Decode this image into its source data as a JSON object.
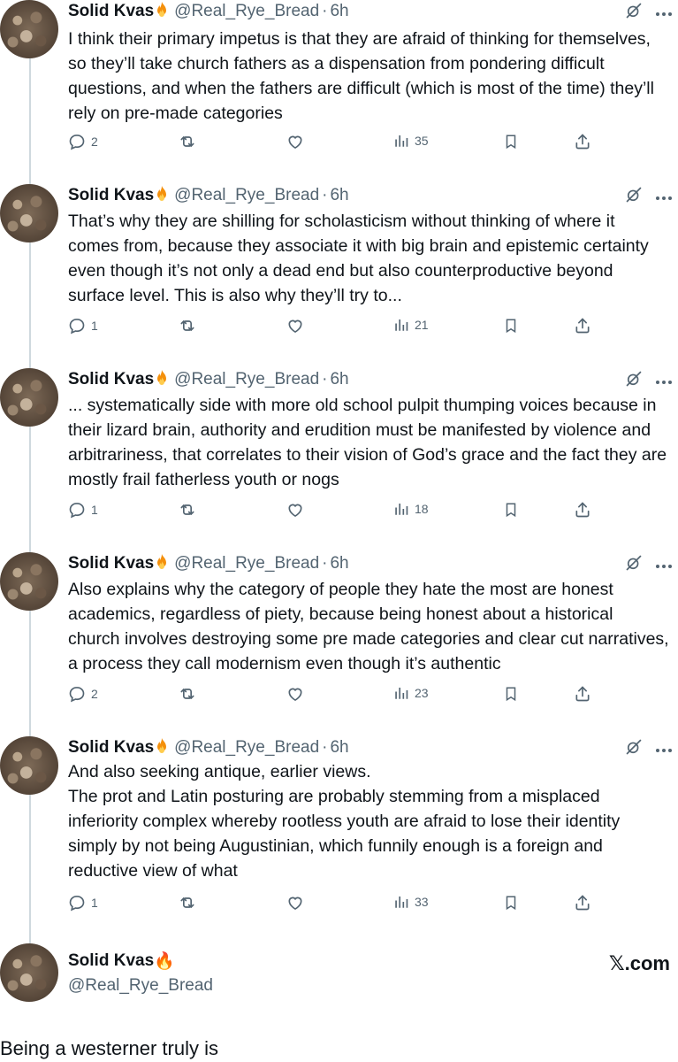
{
  "author": {
    "name": "Solid Kvas",
    "emoji": "🔥",
    "handle": "@Real_Rye_Bread",
    "separator": "·"
  },
  "tweets": [
    {
      "time": "6h",
      "text": "I think their primary impetus is that they are afraid of thinking for themselves, so they’ll take church fathers as a dispensation from pondering difficult questions, and when the fathers are difficult (which is most of the time) they’ll rely on pre-made categories",
      "replies": "2",
      "views": "35"
    },
    {
      "time": "6h",
      "text": "That’s why they are shilling for scholasticism without thinking of where it comes from, because they associate it with big brain and epistemic certainty even though it’s not only a dead end but also counterproductive beyond surface level. This is also why they’ll try to...",
      "replies": "1",
      "views": "21"
    },
    {
      "time": "6h",
      "text": "... systematically side with more old school pulpit thumping voices because in their lizard brain, authority and erudition must be manifested by violence and arbitrariness, that correlates to their vision of God’s grace and the fact they are mostly frail fatherless youth or nogs",
      "replies": "1",
      "views": "18"
    },
    {
      "time": "6h",
      "text": "Also explains why the category of people they hate the most are honest academics, regardless of piety, because being honest about a historical church involves destroying some pre made categories and clear cut narratives, a process they call modernism even though it’s authentic",
      "replies": "2",
      "views": "23"
    },
    {
      "time": "6h",
      "text": "And also seeking antique, earlier views.\nThe prot and Latin posturing are probably stemming from a misplaced inferiority complex whereby rootless youth are afraid to lose their identity simply by not being Augustinian, which funnily enough is a foreign and reductive view of what",
      "replies": "1",
      "views": "33"
    }
  ],
  "footer": {
    "site": "𝕏.com",
    "caption": "Being a westerner truly is"
  },
  "icons": {
    "reply": "reply-icon",
    "retweet": "retweet-icon",
    "like": "like-icon",
    "views": "views-icon",
    "bookmark": "bookmark-icon",
    "share": "share-icon",
    "grok": "grok-icon",
    "more": "more-icon"
  }
}
